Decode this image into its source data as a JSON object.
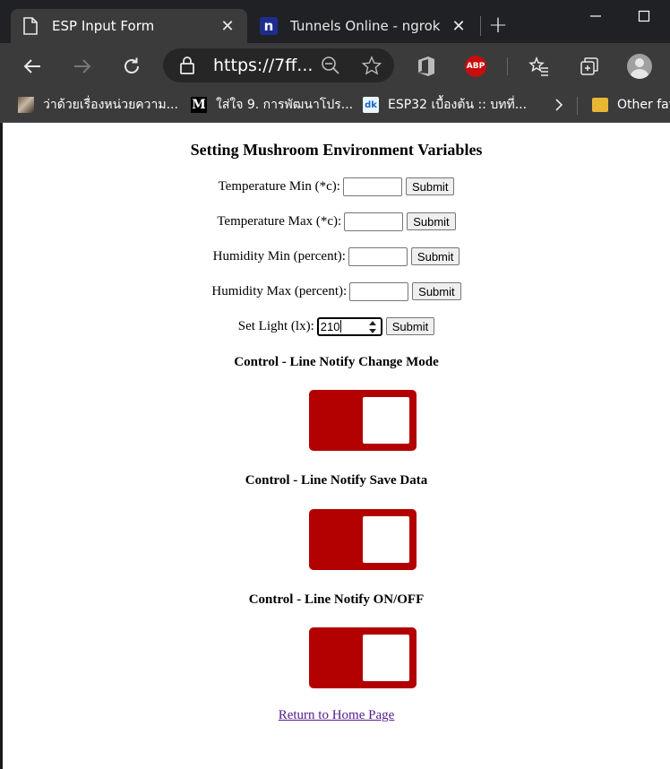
{
  "browser": {
    "tabs": [
      {
        "title": "ESP Input Form",
        "icon": "page-icon",
        "active": true
      },
      {
        "title": "Tunnels Online - ngrok",
        "icon": "ngrok-icon",
        "favicon_letter": "n",
        "active": false
      }
    ],
    "address": {
      "url": "https://7ff..."
    },
    "toolbar_icons": [
      "back-icon",
      "forward-icon",
      "refresh-icon",
      "lock-icon",
      "zoom-icon",
      "star-icon",
      "office-icon",
      "adblock-icon",
      "favorites-icon",
      "collections-icon",
      "profile-icon"
    ],
    "adblock_label": "ABP",
    "bookmarks": [
      {
        "label": "ว่าด้วยเรื่องหน่วยความ...",
        "icon": "photo-icon"
      },
      {
        "label": "ใส่ใจ 9. การพัฒนาโปร...",
        "icon": "medium-icon",
        "icon_letter": "M"
      },
      {
        "label": "ESP32 เบื้องต้น :: บทที่...",
        "icon": "site-icon",
        "icon_letter": "dk"
      },
      {
        "label": "Other fav",
        "icon": "folder-icon"
      }
    ]
  },
  "page": {
    "title": "Setting Mushroom Environment Variables",
    "fields": [
      {
        "label": "Temperature Min (*c):",
        "value": "",
        "submit": "Submit"
      },
      {
        "label": "Temperature Max (*c):",
        "value": "",
        "submit": "Submit"
      },
      {
        "label": "Humidity Min (percent):",
        "value": "",
        "submit": "Submit"
      },
      {
        "label": "Humidity Max (percent):",
        "value": "",
        "submit": "Submit"
      },
      {
        "label": "Set Light (lx):",
        "value": "210",
        "submit": "Submit"
      }
    ],
    "controls": [
      {
        "title": "Control - Line Notify Change Mode",
        "state": "on"
      },
      {
        "title": "Control - Line Notify Save Data",
        "state": "on"
      },
      {
        "title": "Control - Line Notify ON/OFF",
        "state": "on"
      }
    ],
    "toggle_color": "#b30000",
    "home_link": "Return to Home Page"
  }
}
